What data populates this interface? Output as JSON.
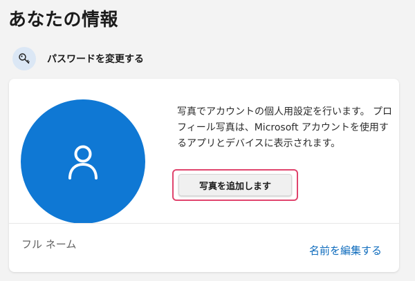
{
  "page": {
    "title": "あなたの情報"
  },
  "password_row": {
    "icon": "key-icon",
    "label": "パスワードを変更する"
  },
  "profile_card": {
    "avatar_icon": "person-icon",
    "avatar_color": "#0f78d4",
    "description": "写真でアカウントの個人用設定を行います。 プロフィール写真は、Microsoft アカウントを使用するアプリとデバイスに表示されます。",
    "add_photo_label": "写真を追加します",
    "highlight_color": "#e0446d",
    "full_name_label": "フル ネーム",
    "edit_name_label": "名前を編集する",
    "link_color": "#0f6cbd"
  }
}
